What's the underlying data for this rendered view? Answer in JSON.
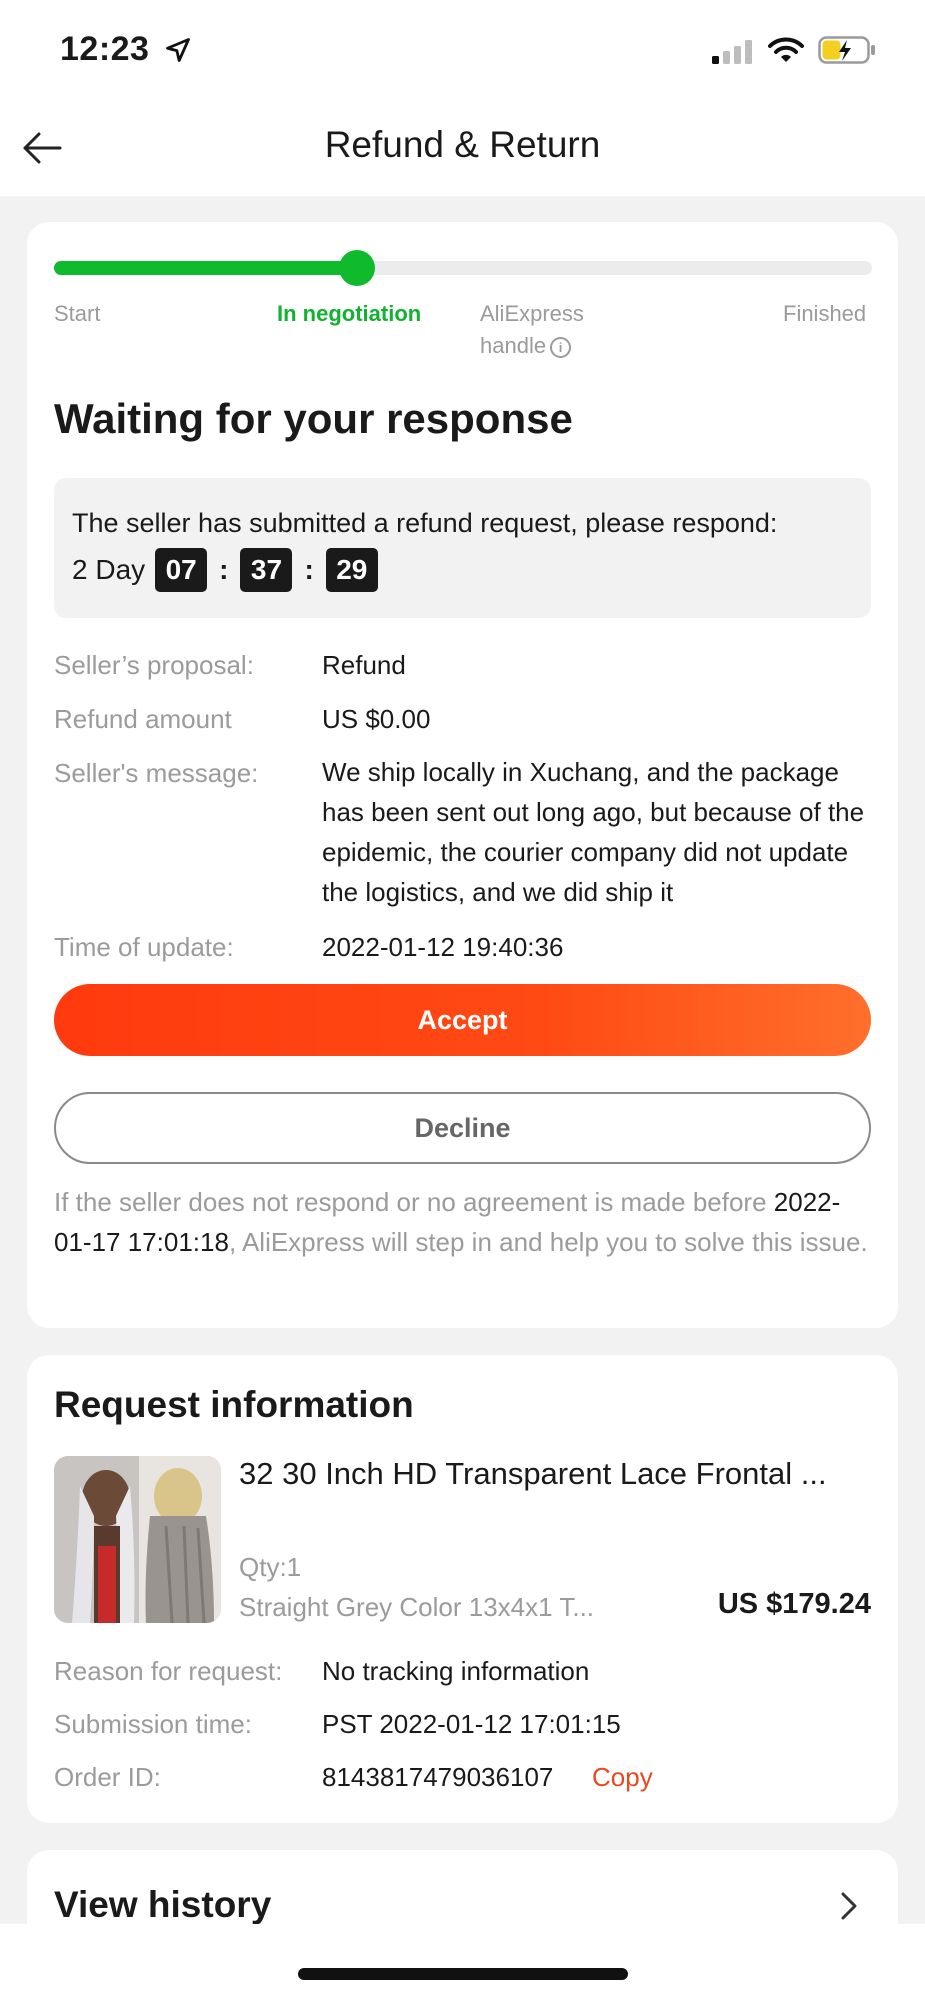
{
  "status_bar": {
    "time": "12:23"
  },
  "nav": {
    "title": "Refund & Return"
  },
  "progress": {
    "steps": [
      "Start",
      "In negotiation",
      "AliExpress",
      "handle",
      "Finished"
    ],
    "active_step": "In negotiation",
    "fraction": 0.37
  },
  "status": {
    "heading": "Waiting for your response",
    "notice": "The seller has submitted a refund request, please respond:",
    "countdown": {
      "day_label": "2 Day",
      "hours": "07",
      "minutes": "37",
      "seconds": "29",
      "separator": ":"
    }
  },
  "proposal": {
    "seller_proposal_label": "Seller’s proposal:",
    "seller_proposal_value": "Refund",
    "refund_amount_label": "Refund amount",
    "refund_amount_value": "US $0.00",
    "message_label": "Seller's message:",
    "message_value": "We ship locally in Xuchang, and the package has been sent out long ago, but because of the epidemic, the courier company did not update the logistics, and we did ship it",
    "update_label": "Time of update:",
    "update_value": "2022-01-12 19:40:36"
  },
  "actions": {
    "accept": "Accept",
    "decline": "Decline"
  },
  "footnote": {
    "before": "If the seller does not respond or no agreement is made before",
    "date": "2022-01-17 17:01:18",
    "after": ", AliExpress will step in and help you to solve this issue."
  },
  "request": {
    "title": "Request information",
    "product_title": "32 30 Inch HD Transparent Lace Frontal ...",
    "qty": "Qty:1",
    "variant": "Straight Grey Color 13x4x1 T...",
    "price": "US $179.24",
    "reason_label": "Reason for request:",
    "reason_value": "No tracking information",
    "submission_label": "Submission time:",
    "submission_value": "PST 2022-01-12 17:01:15",
    "order_label": "Order ID:",
    "order_value": "8143817479036107",
    "copy_label": "Copy"
  },
  "history": {
    "title": "View history"
  },
  "colors": {
    "green": "#0fba2c",
    "accent": "#ff4a14",
    "copy": "#ea4820"
  }
}
